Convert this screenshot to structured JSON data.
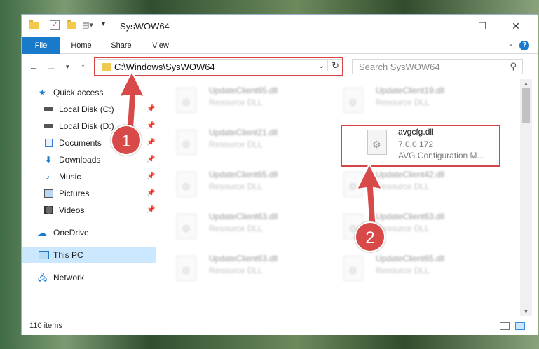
{
  "window": {
    "title": "SysWOW64"
  },
  "ribbon": {
    "tabs": [
      {
        "label": "File"
      },
      {
        "label": "Home"
      },
      {
        "label": "Share"
      },
      {
        "label": "View"
      }
    ],
    "help": "?"
  },
  "address": {
    "path": "C:\\Windows\\SysWOW64",
    "search_placeholder": "Search SysWOW64"
  },
  "sidebar": {
    "items": [
      {
        "label": "Quick access",
        "icon": "star-icon"
      },
      {
        "label": "Local Disk (C:)",
        "icon": "drive-icon",
        "pinned": true
      },
      {
        "label": "Local Disk (D:)",
        "icon": "drive-icon",
        "pinned": true
      },
      {
        "label": "Documents",
        "icon": "documents-icon",
        "pinned": true
      },
      {
        "label": "Downloads",
        "icon": "download-icon",
        "pinned": true
      },
      {
        "label": "Music",
        "icon": "music-icon",
        "pinned": true
      },
      {
        "label": "Pictures",
        "icon": "pictures-icon",
        "pinned": true
      },
      {
        "label": "Videos",
        "icon": "videos-icon",
        "pinned": true
      },
      {
        "label": "OneDrive",
        "icon": "cloud-icon"
      },
      {
        "label": "This PC",
        "icon": "computer-icon",
        "selected": true
      },
      {
        "label": "Network",
        "icon": "network-icon"
      }
    ]
  },
  "files": [
    {
      "name": "UpdateClient65.dll",
      "type": "Resource DLL",
      "blurred": true
    },
    {
      "name": "UpdateClient19.dll",
      "type": "Resource DLL",
      "blurred": true
    },
    {
      "name": "UpdateClient21.dll",
      "type": "Resource DLL",
      "blurred": true
    },
    {
      "name": "avgcfg.dll",
      "version": "7.0.0.172",
      "type": "AVG Configuration M...",
      "blurred": false
    },
    {
      "name": "UpdateClient65.dll",
      "type": "Resource DLL",
      "blurred": true
    },
    {
      "name": "UpdateClient42.dll",
      "type": "Resource DLL",
      "blurred": true
    },
    {
      "name": "UpdateClient63.dll",
      "type": "Resource DLL",
      "blurred": true
    },
    {
      "name": "UpdateClient63.dll",
      "type": "Resource DLL",
      "blurred": true
    },
    {
      "name": "UpdateClient63.dll",
      "type": "Resource DLL",
      "blurred": true
    },
    {
      "name": "UpdateClient65.dll",
      "type": "Resource DLL",
      "blurred": true
    }
  ],
  "status": {
    "item_count": "110 items"
  },
  "annotations": {
    "step1": "1",
    "step2": "2",
    "color": "#d64545"
  }
}
